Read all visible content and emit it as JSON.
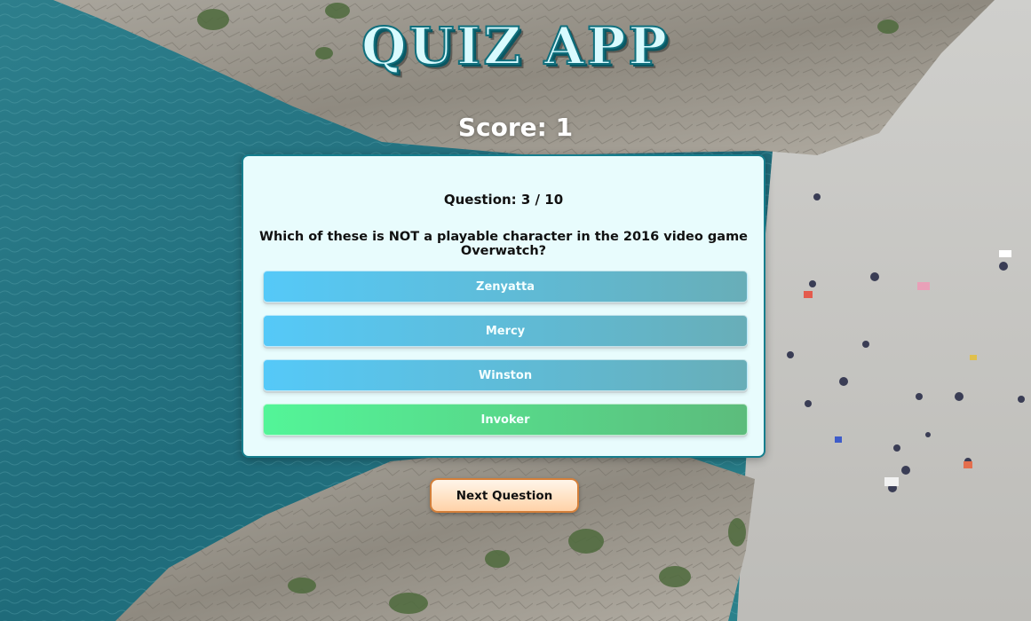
{
  "app": {
    "title": "QUIZ APP"
  },
  "score": {
    "text": "Score: 1"
  },
  "question": {
    "counter": "Question: 3 / 10",
    "text": "Which of these is NOT a playable character in the 2016 video game Overwatch?"
  },
  "answers": [
    {
      "label": "Zenyatta",
      "state": "normal"
    },
    {
      "label": "Mercy",
      "state": "normal"
    },
    {
      "label": "Winston",
      "state": "normal"
    },
    {
      "label": "Invoker",
      "state": "correct"
    }
  ],
  "next_button": {
    "label": "Next Question"
  },
  "colors": {
    "card_bg": "#e8fcfd",
    "card_border": "#167e8d",
    "answer_gradient_start": "#55c9f8",
    "answer_gradient_end": "#68aeb8",
    "correct_gradient_start": "#53f598",
    "correct_gradient_end": "#5cbc7c",
    "next_button_border": "#d37f3a"
  }
}
